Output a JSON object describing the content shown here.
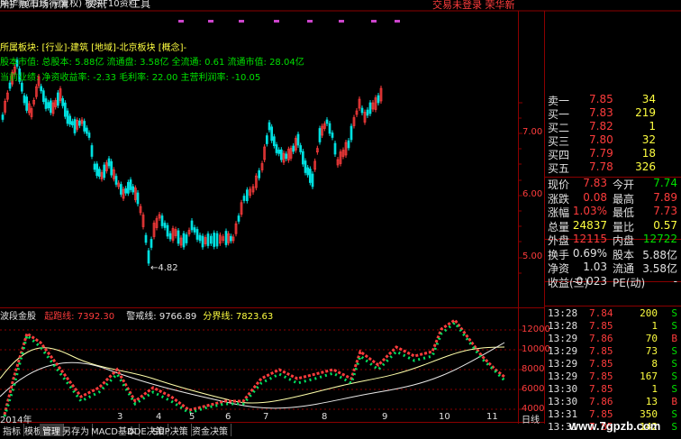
{
  "topbar": {
    "stock_label": "荣华新(日线 前复权) 板块F10资料",
    "right_label": "交易未登录  荣华新"
  },
  "menus": [
    "所",
    "扩展市场行情",
    "资讯",
    "工具"
  ],
  "info": {
    "line1": "所属板块: [行业]-建筑 [地域]-北京板块 [概念]-",
    "line2": "股本市值: 总股本: 5.88亿 流通盘: 3.58亿 全流通: 0.61 流通市值: 28.04亿",
    "line3": "当前业绩: 净资收益率: -2.33 毛利率: 22.00 主营利润率: -10.05"
  },
  "price_axis": [
    "7.00",
    "6.00",
    "5.00"
  ],
  "min_price_label": "←4.82",
  "indicator": {
    "name": "波段金股",
    "l1": "起跑线: 7392.30",
    "l2": "警戒线: 9766.89",
    "l3": "分界线: 7823.63"
  },
  "ind_axis": [
    "12000",
    "10000",
    "8000",
    "6000",
    "4000"
  ],
  "date_axis": [
    "2014年",
    "3",
    "4",
    "5",
    "6",
    "7",
    "8",
    "9",
    "10",
    "11"
  ],
  "period_label": "日线",
  "quote_top": [
    {
      "label": "卖一",
      "price": "7.85",
      "vol": "34"
    },
    {
      "label": "买一",
      "price": "7.83",
      "vol": "219"
    },
    {
      "label": "买二",
      "price": "7.82",
      "vol": "1"
    },
    {
      "label": "买三",
      "price": "7.80",
      "vol": "32"
    },
    {
      "label": "买四",
      "price": "7.79",
      "vol": "18"
    },
    {
      "label": "买五",
      "price": "7.78",
      "vol": "326"
    }
  ],
  "quote_stats": [
    {
      "l1": "现价",
      "v1": "7.83",
      "l2": "今开",
      "v2": "7.74"
    },
    {
      "l1": "涨跌",
      "v1": "0.08",
      "l2": "最高",
      "v2": "7.89"
    },
    {
      "l1": "涨幅",
      "v1": "1.03%",
      "l2": "最低",
      "v2": "7.73"
    },
    {
      "l1": "总量",
      "v1": "24837",
      "l2": "量比",
      "v2": "0.57"
    },
    {
      "l1": "外盘",
      "v1": "12115",
      "l2": "内盘",
      "v2": "12722"
    },
    {
      "l1": "换手",
      "v1": "0.69%",
      "l2": "股本",
      "v2": "5.88亿"
    },
    {
      "l1": "净资",
      "v1": "1.03",
      "l2": "流通",
      "v2": "3.58亿"
    },
    {
      "l1": "收益(三)",
      "v1": "-0.023",
      "l2": "PE(动)",
      "v2": "-"
    }
  ],
  "ticks": [
    {
      "time": "13:28",
      "price": "7.84",
      "vol": "200",
      "side": "S"
    },
    {
      "time": "13:28",
      "price": "7.85",
      "vol": "1",
      "side": "S"
    },
    {
      "time": "13:29",
      "price": "7.86",
      "vol": "70",
      "side": "B"
    },
    {
      "time": "13:29",
      "price": "7.85",
      "vol": "73",
      "side": "S"
    },
    {
      "time": "13:29",
      "price": "7.85",
      "vol": "8",
      "side": "S"
    },
    {
      "time": "13:29",
      "price": "7.85",
      "vol": "167",
      "side": "S"
    },
    {
      "time": "13:30",
      "price": "7.85",
      "vol": "1",
      "side": "S"
    },
    {
      "time": "13:30",
      "price": "7.86",
      "vol": "13",
      "side": "B"
    },
    {
      "time": "13:31",
      "price": "7.85",
      "vol": "350",
      "side": "S"
    },
    {
      "time": "13:31",
      "price": "7.85",
      "vol": "142",
      "side": "S"
    }
  ],
  "bottom_tabs": [
    "指标",
    "模板",
    "管理",
    "另存为",
    "MACD基本",
    "DDE决策",
    "SUP决策",
    "资金决策"
  ],
  "watermark": "www.7gpzb.com",
  "colors": {
    "up": "#ff3c3c",
    "down": "#00e0e0",
    "bg": "#000000",
    "grid": "#8b0000"
  }
}
